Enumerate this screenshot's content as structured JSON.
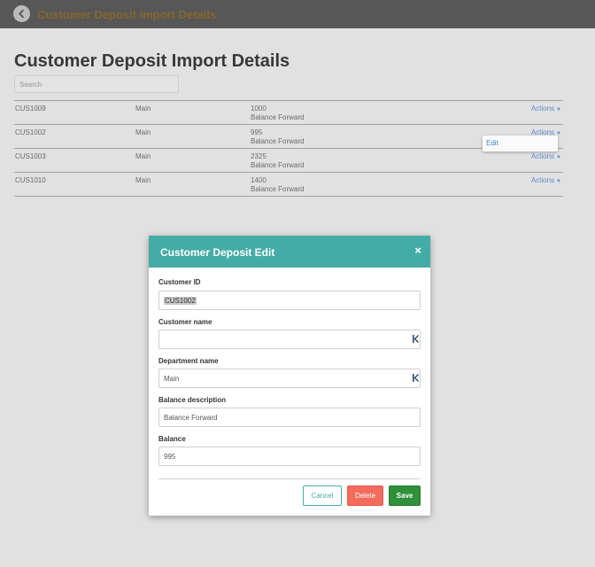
{
  "topbar": {
    "title": "Customer Deposit Import Details",
    "back_icon": "arrow-left-circle-icon"
  },
  "page": {
    "title": "Customer Deposit Import Details",
    "search_placeholder": "Search"
  },
  "table": {
    "rows": [
      {
        "customer_id": "CUS1009",
        "department": "Main",
        "balance": "1000",
        "description": "Balance Forward",
        "actions": "Actions"
      },
      {
        "customer_id": "CUS1002",
        "department": "Main",
        "balance": "995",
        "description": "Balance Forward",
        "actions": "Actions"
      },
      {
        "customer_id": "CUS1003",
        "department": "Main",
        "balance": "2325",
        "description": "Balance Forward",
        "actions": "Actions"
      },
      {
        "customer_id": "CUS1010",
        "department": "Main",
        "balance": "1400",
        "description": "Balance Forward",
        "actions": "Actions"
      }
    ]
  },
  "actions_menu": {
    "items": [
      "Edit"
    ]
  },
  "modal": {
    "title": "Customer Deposit Edit",
    "close": "×",
    "fields": {
      "customer_id": {
        "label": "Customer ID",
        "value": "CUS1002"
      },
      "customer_name": {
        "label": "Customer name",
        "value": ""
      },
      "department_name": {
        "label": "Department name",
        "value": "Main"
      },
      "balance_description": {
        "label": "Balance description",
        "value": "Balance Forward"
      },
      "balance": {
        "label": "Balance",
        "value": "995"
      }
    },
    "buttons": {
      "cancel": "Cancel",
      "delete": "Delete",
      "save": "Save"
    }
  },
  "colors": {
    "topbar": "#595959",
    "topbar_title": "#8a6a2e",
    "modal_header": "#44aca6",
    "delete": "#f26b5b",
    "save": "#2f8f3a",
    "link": "#5a8fcf"
  }
}
